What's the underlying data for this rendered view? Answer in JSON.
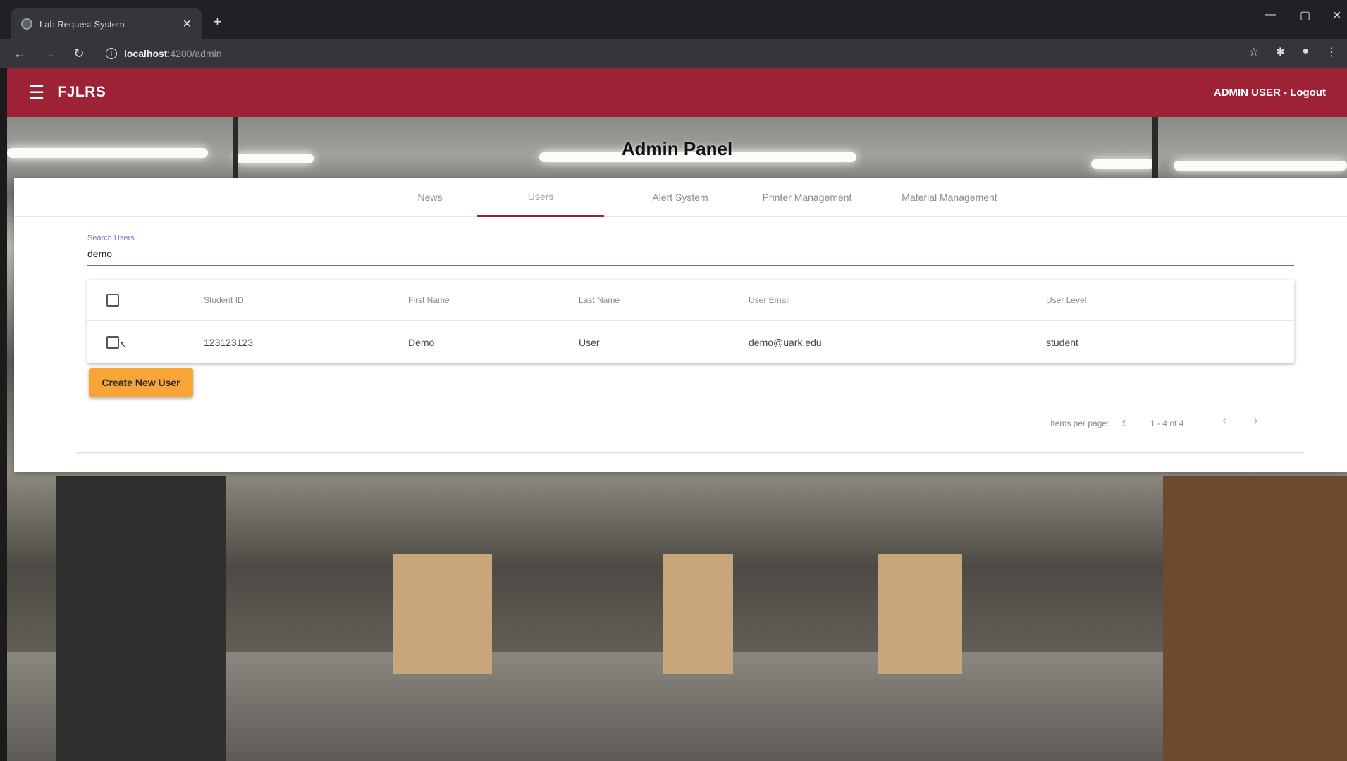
{
  "browser": {
    "tab_title": "Lab Request System",
    "url_host": "localhost",
    "url_path": ":4200/admin",
    "icons": {
      "back": "arrow-left-icon",
      "forward": "arrow-right-icon",
      "reload": "reload-icon",
      "info": "info-icon",
      "bookmark": "star-icon",
      "extensions": "puzzle-icon",
      "profile": "person-icon",
      "menu": "vertical-dots-icon"
    }
  },
  "header": {
    "brand": "FJLRS",
    "user_logout": "ADMIN USER - Logout",
    "color": "#9d2235"
  },
  "page": {
    "title": "Admin Panel"
  },
  "tabs": [
    {
      "label": "News"
    },
    {
      "label": "Users"
    },
    {
      "label": "Alert System"
    },
    {
      "label": "Printer Management"
    },
    {
      "label": "Material Management"
    }
  ],
  "active_tab": "Users",
  "search": {
    "label": "Search Users",
    "value": "demo"
  },
  "table": {
    "columns": [
      "Student ID",
      "First Name",
      "Last Name",
      "User Email",
      "User Level"
    ],
    "rows": [
      {
        "student_id": "123123123",
        "first_name": "Demo",
        "last_name": "User",
        "email": "demo@uark.edu",
        "level": "student"
      }
    ]
  },
  "create_button": {
    "label": "Create New User",
    "color": "#f7a536"
  },
  "paginator": {
    "items_per_page_label": "Items per page:",
    "items_per_page_value": "5",
    "range": "1 - 4 of 4"
  }
}
